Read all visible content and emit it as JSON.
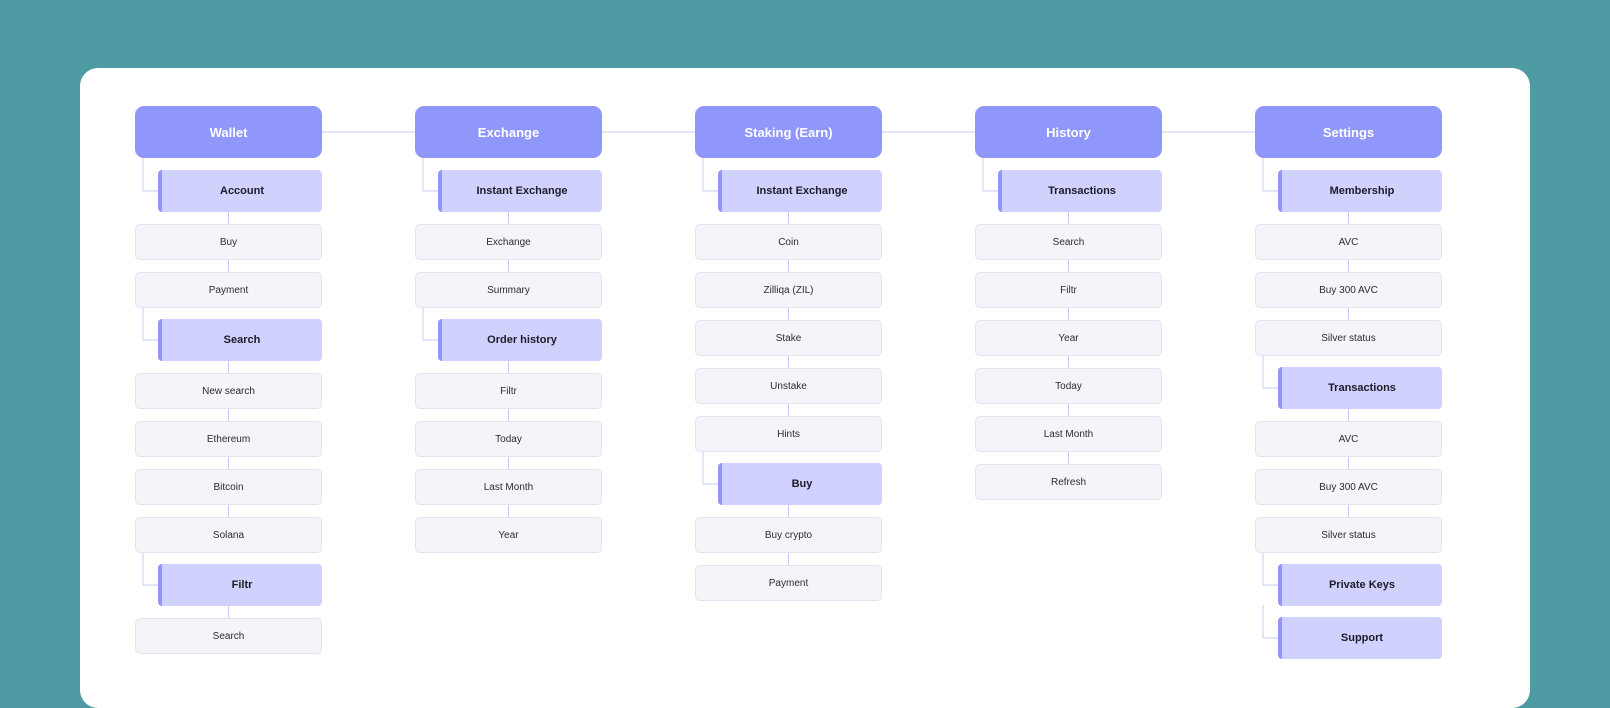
{
  "background_color": "#4e9ba4",
  "colors": {
    "top_node": "#8f97fb",
    "section_node": "#d0d1fd",
    "leaf_node": "#f5f4f8",
    "connector": "#c9c8f5"
  },
  "columns": [
    {
      "title": "Wallet",
      "items": [
        {
          "label": "Account",
          "kind": "section"
        },
        {
          "label": "Buy",
          "kind": "leaf"
        },
        {
          "label": "Payment",
          "kind": "leaf"
        },
        {
          "label": "Search",
          "kind": "section"
        },
        {
          "label": "New search",
          "kind": "leaf"
        },
        {
          "label": "Ethereum",
          "kind": "leaf"
        },
        {
          "label": "Bitcoin",
          "kind": "leaf"
        },
        {
          "label": "Solana",
          "kind": "leaf"
        },
        {
          "label": "Filtr",
          "kind": "section"
        },
        {
          "label": "Search",
          "kind": "leaf"
        }
      ]
    },
    {
      "title": "Exchange",
      "items": [
        {
          "label": "Instant Exchange",
          "kind": "section"
        },
        {
          "label": "Exchange",
          "kind": "leaf"
        },
        {
          "label": "Summary",
          "kind": "leaf"
        },
        {
          "label": "Order history",
          "kind": "section"
        },
        {
          "label": "Filtr",
          "kind": "leaf"
        },
        {
          "label": "Today",
          "kind": "leaf"
        },
        {
          "label": "Last Month",
          "kind": "leaf"
        },
        {
          "label": "Year",
          "kind": "leaf"
        }
      ]
    },
    {
      "title": "Staking (Earn)",
      "items": [
        {
          "label": "Instant Exchange",
          "kind": "section"
        },
        {
          "label": "Coin",
          "kind": "leaf"
        },
        {
          "label": "Zilliqa (ZIL)",
          "kind": "leaf"
        },
        {
          "label": "Stake",
          "kind": "leaf"
        },
        {
          "label": "Unstake",
          "kind": "leaf"
        },
        {
          "label": "Hints",
          "kind": "leaf"
        },
        {
          "label": "Buy",
          "kind": "section"
        },
        {
          "label": "Buy crypto",
          "kind": "leaf"
        },
        {
          "label": "Payment",
          "kind": "leaf"
        }
      ]
    },
    {
      "title": "History",
      "items": [
        {
          "label": "Transactions",
          "kind": "section"
        },
        {
          "label": "Search",
          "kind": "leaf"
        },
        {
          "label": "Filtr",
          "kind": "leaf"
        },
        {
          "label": "Year",
          "kind": "leaf"
        },
        {
          "label": "Today",
          "kind": "leaf"
        },
        {
          "label": "Last Month",
          "kind": "leaf"
        },
        {
          "label": "Refresh",
          "kind": "leaf"
        }
      ]
    },
    {
      "title": "Settings",
      "items": [
        {
          "label": "Membership",
          "kind": "section"
        },
        {
          "label": "AVC",
          "kind": "leaf"
        },
        {
          "label": "Buy 300 AVC",
          "kind": "leaf"
        },
        {
          "label": "Silver status",
          "kind": "leaf"
        },
        {
          "label": "Transactions",
          "kind": "section"
        },
        {
          "label": "AVC",
          "kind": "leaf"
        },
        {
          "label": "Buy 300 AVC",
          "kind": "leaf"
        },
        {
          "label": "Silver status",
          "kind": "leaf"
        },
        {
          "label": "Private Keys",
          "kind": "section"
        },
        {
          "label": "Support",
          "kind": "section"
        }
      ]
    }
  ]
}
